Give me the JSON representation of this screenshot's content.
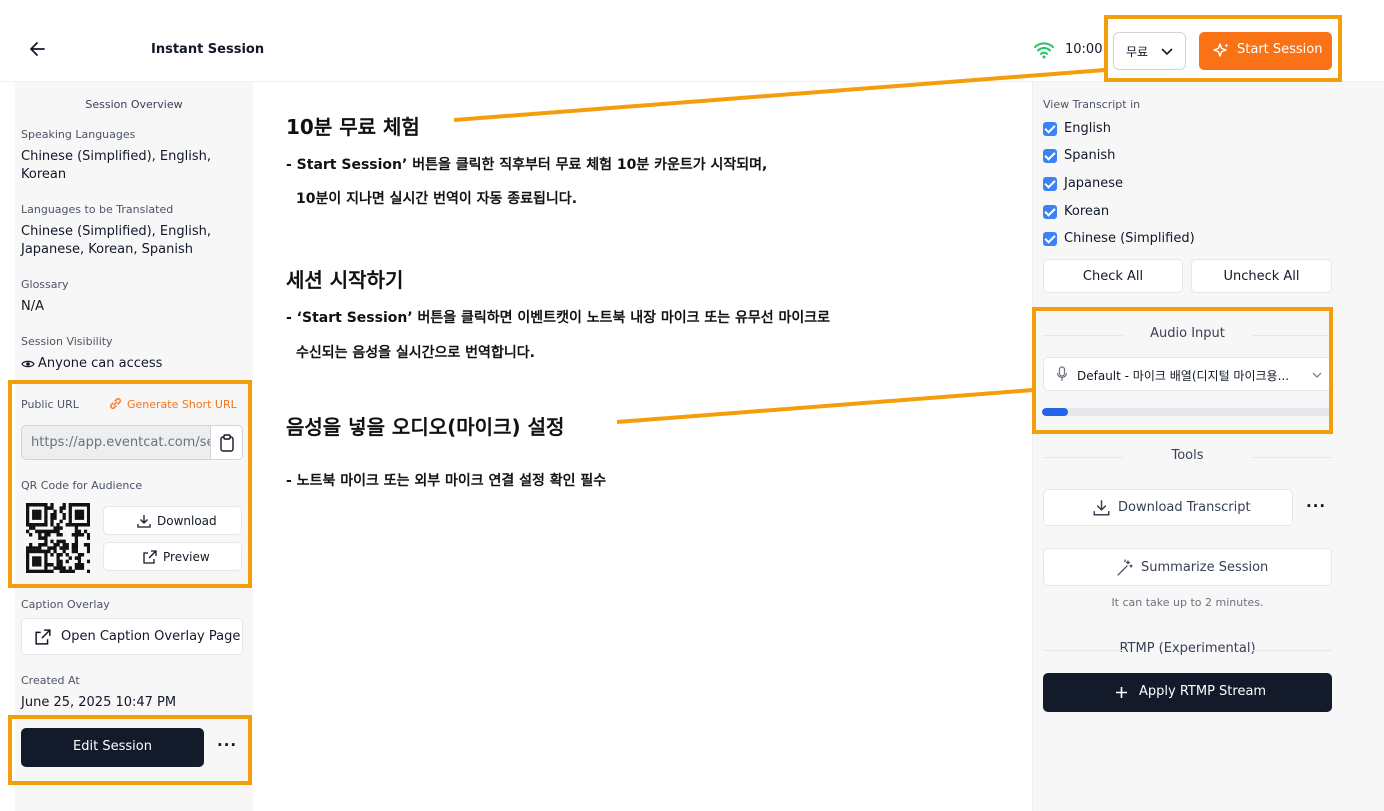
{
  "header": {
    "title": "Instant Session",
    "timer": "10:00",
    "plan_select": "무료",
    "start_label": "Start Session",
    "colors": {
      "accent": "#f97316",
      "wifi": "#22c55e",
      "highlight": "#f59e0b",
      "dark_button": "#131a2a"
    }
  },
  "overview": {
    "heading": "Session Overview",
    "speaking_label": "Speaking Languages",
    "speaking_value_1": "Chinese (Simplified), English,",
    "speaking_value_2": "Korean",
    "translated_label": "Languages to be Translated",
    "translated_value_1": "Chinese (Simplified), English,",
    "translated_value_2": "Japanese, Korean, Spanish",
    "glossary_label": "Glossary",
    "glossary_value": "N/A",
    "visibility_label": "Session Visibility",
    "visibility_value": "Anyone can access",
    "public_url_label": "Public URL",
    "generate_label": "Generate Short URL",
    "public_url_value": "https://app.eventcat.com/se",
    "qr_label": "QR Code for Audience",
    "download_label": "Download",
    "preview_label": "Preview",
    "caption_label": "Caption Overlay",
    "caption_button": "Open Caption Overlay Page",
    "created_label": "Created At",
    "created_value": "June 25, 2025 10:47 PM",
    "edit_label": "Edit Session",
    "more_label": "···"
  },
  "guide": {
    "h1": "10분 무료 체험",
    "p1a": "- Start Session’ 버튼을 클릭한 직후부터 무료 체험 10분 카운트가 시작되며,",
    "p1b": "10분이 지나면 실시간 번역이 자동 종료됩니다.",
    "h2": "세션 시작하기",
    "p2a": "- ‘Start Session’ 버튼을 클릭하면 이벤트캣이 노트북 내장 마이크 또는 유무선 마이크로",
    "p2b": "수신되는 음성을 실시간으로 번역합니다.",
    "h3": "음성을 넣을 오디오(마이크) 설정",
    "p3": "- 노트북 마이크 또는 외부 마이크 연결 설정 확인 필수"
  },
  "panel": {
    "transcript_label": "View Transcript in",
    "languages": [
      "English",
      "Spanish",
      "Japanese",
      "Korean",
      "Chinese (Simplified)"
    ],
    "check_all": "Check All",
    "uncheck_all": "Uncheck All",
    "audio_heading": "Audio Input",
    "audio_device": "Default - 마이크 배열(디지털 마이크용...",
    "audio_level": 0.09,
    "tools_heading": "Tools",
    "download_transcript": "Download Transcript",
    "more_label": "···",
    "summarize": "Summarize Session",
    "summarize_note": "It can take up to 2 minutes.",
    "rtmp_heading": "RTMP (Experimental)",
    "rtmp_button": "Apply RTMP Stream"
  }
}
